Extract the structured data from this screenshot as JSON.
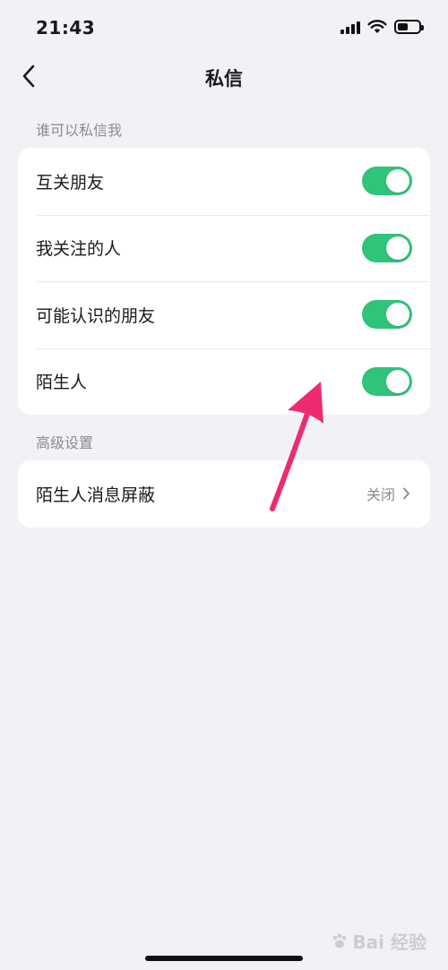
{
  "status_bar": {
    "time": "21:43",
    "icons": [
      "signal-icon",
      "wifi-icon",
      "battery-icon"
    ]
  },
  "nav": {
    "title": "私信",
    "back_icon": "chevron-left-icon"
  },
  "section_who": {
    "header": "谁可以私信我",
    "items": [
      {
        "label": "互关朋友",
        "enabled": true
      },
      {
        "label": "我关注的人",
        "enabled": true
      },
      {
        "label": "可能认识的朋友",
        "enabled": true
      },
      {
        "label": "陌生人",
        "enabled": true
      }
    ]
  },
  "section_advanced": {
    "header": "高级设置",
    "items": [
      {
        "label": "陌生人消息屏蔽",
        "value": "关闭"
      }
    ]
  },
  "watermark": {
    "text": "Bai 经验"
  },
  "colors": {
    "background": "#f2f2f6",
    "toggle_on": "#30c37a",
    "annotation_arrow": "#ee2b72",
    "secondary_text": "#8a8a8f"
  }
}
